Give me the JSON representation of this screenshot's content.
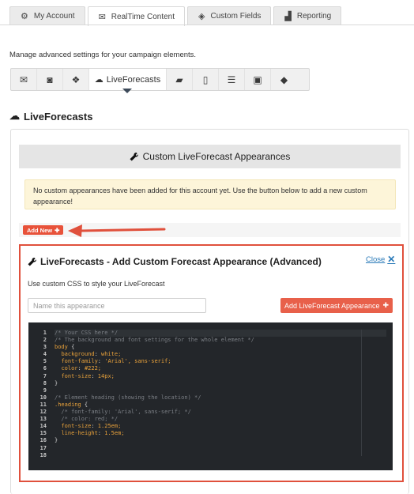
{
  "top_tabs": [
    {
      "label": "My Account",
      "icon": "gear-icon",
      "glyph": "⚙"
    },
    {
      "label": "RealTime Content",
      "icon": "envelope-icon",
      "glyph": "✉"
    },
    {
      "label": "Custom Fields",
      "icon": "tag-icon",
      "glyph": "◈"
    },
    {
      "label": "Reporting",
      "icon": "chart-icon",
      "glyph": "▟"
    }
  ],
  "description": "Manage advanced settings for your campaign elements.",
  "icon_tabs": {
    "active_label": "LiveForecasts",
    "icons": [
      "envelope-icon",
      "rss-icon",
      "chat-icon",
      "weather-icon",
      "truck-icon",
      "map-icon",
      "list-icon",
      "gift-icon",
      "ticket-icon"
    ],
    "glyphs": [
      "✉",
      "◙",
      "❖",
      "☁",
      "▰",
      "▯",
      "☰",
      "▣",
      "◆"
    ]
  },
  "section_title": "LiveForecasts",
  "custom_header": "Custom LiveForecast Appearances",
  "notice": "No custom appearances have been added for this account yet. Use the button below to add a new custom appearance!",
  "add_new_label": "Add New",
  "modal": {
    "title": "LiveForecasts - Add Custom Forecast Appearance (Advanced)",
    "close_label": "Close",
    "description": "Use custom CSS to style your LiveForecast",
    "name_placeholder": "Name this appearance",
    "add_button_label": "Add LiveForecast Appearance"
  },
  "code_lines": [
    "/* Your CSS here */",
    "/* The background and font settings for the whole element */",
    "body {",
    "  background: white;",
    "  font-family: 'Arial', sans-serif;",
    "  color: #222;",
    "  font-size: 14px;",
    "}",
    "",
    "/* Element heading (showing the location) */",
    ".heading {",
    "  /* font-family: 'Arial', sans-serif; */",
    "  /* color: red; */",
    "  font-size: 1.25em;",
    "  line-height: 1.5em;",
    "}",
    "",
    ""
  ],
  "colors": {
    "accent": "#e8523a",
    "highlight_border": "#e0503c",
    "editor_bg": "#23262a",
    "link": "#2a7ab8"
  }
}
